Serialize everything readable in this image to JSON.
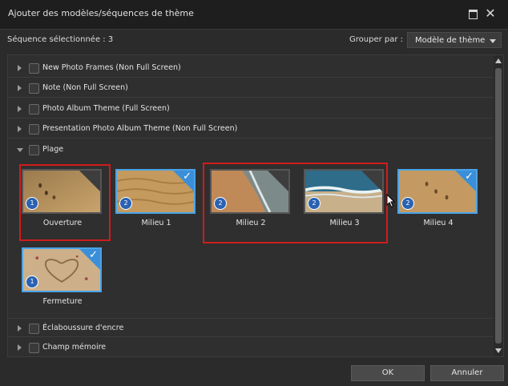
{
  "window": {
    "title": "Ajouter des modèles/séquences de thème"
  },
  "toolbar": {
    "selected_count": "Séquence sélectionnée : 3",
    "group_by_label": "Grouper par :",
    "group_by_value": "Modèle de thème"
  },
  "groups_top": [
    {
      "label": "New Photo Frames (Non Full Screen)"
    },
    {
      "label": "Note (Non Full Screen)"
    },
    {
      "label": "Photo Album Theme (Full Screen)"
    },
    {
      "label": "Presentation Photo Album Theme (Non Full Screen)"
    }
  ],
  "open_group": {
    "label": "Plage",
    "items": [
      {
        "caption": "Ouverture",
        "badge": "1",
        "selected": false
      },
      {
        "caption": "Milieu 1",
        "badge": "2",
        "selected": true
      },
      {
        "caption": "Milieu 2",
        "badge": "2",
        "selected": false
      },
      {
        "caption": "Milieu 3",
        "badge": "2",
        "selected": false
      },
      {
        "caption": "Milieu 4",
        "badge": "2",
        "selected": true
      },
      {
        "caption": "Fermeture",
        "badge": "1",
        "selected": true
      }
    ]
  },
  "groups_bottom": [
    {
      "label": "Éclaboussure d'encre"
    },
    {
      "label": "Champ mémoire"
    }
  ],
  "buttons": {
    "ok": "OK",
    "cancel": "Annuler"
  },
  "colors": {
    "highlight_box": "#d01c1c",
    "selection_blue": "#3b8fd8",
    "badge_blue": "#2a62b3"
  }
}
